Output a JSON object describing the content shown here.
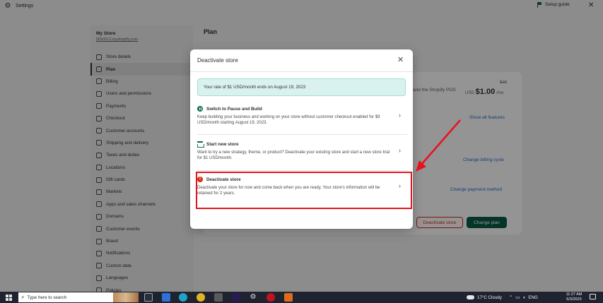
{
  "window": {
    "title": "Settings",
    "setup_guide": "Setup guide",
    "close": "✕"
  },
  "sidebar": {
    "store_name": "My Store",
    "store_url": "5f0c53-2.myshopify.com",
    "items": [
      {
        "label": "Store details",
        "icon": "store-icon"
      },
      {
        "label": "Plan",
        "icon": "plan-icon",
        "active": true
      },
      {
        "label": "Billing",
        "icon": "billing-icon"
      },
      {
        "label": "Users and permissions",
        "icon": "users-icon"
      },
      {
        "label": "Payments",
        "icon": "payments-icon"
      },
      {
        "label": "Checkout",
        "icon": "checkout-icon"
      },
      {
        "label": "Customer accounts",
        "icon": "customer-accounts-icon"
      },
      {
        "label": "Shipping and delivery",
        "icon": "shipping-icon"
      },
      {
        "label": "Taxes and duties",
        "icon": "taxes-icon"
      },
      {
        "label": "Locations",
        "icon": "location-icon"
      },
      {
        "label": "Gift cards",
        "icon": "gift-card-icon"
      },
      {
        "label": "Markets",
        "icon": "markets-icon"
      },
      {
        "label": "Apps and sales channels",
        "icon": "apps-icon"
      },
      {
        "label": "Domains",
        "icon": "domains-icon"
      },
      {
        "label": "Customer events",
        "icon": "customer-events-icon"
      },
      {
        "label": "Brand",
        "icon": "brand-icon"
      },
      {
        "label": "Notifications",
        "icon": "notifications-icon"
      },
      {
        "label": "Custom data",
        "icon": "custom-data-icon"
      },
      {
        "label": "Languages",
        "icon": "languages-icon"
      },
      {
        "label": "Policies",
        "icon": "policies-icon"
      }
    ]
  },
  "main": {
    "page_title": "Plan",
    "pos_text": "and the Shopify POS",
    "price_old": "$29",
    "price_currency": "USD",
    "price_value": "$1.00",
    "price_period": "/mo",
    "show_all_features": "Show all features",
    "change_billing_cycle": "Change billing cycle",
    "change_payment_method": "Change payment method",
    "deactivate_store_button": "Deactivate store",
    "change_plan_button": "Change plan"
  },
  "modal": {
    "title": "Deactivate store",
    "close": "✕",
    "banner": "Your rate of $1 USD/month ends on August 19, 2023",
    "options": [
      {
        "title": "Switch to Pause and Build",
        "description": "Keep building your business and working on your store without customer checkout enabled for $9 USD/month starting August 19, 2023.",
        "icon": "pause-icon"
      },
      {
        "title": "Start new store",
        "description": "Want to try a new strategy, theme, or product? Deactivate your existing store and start a new store trial for $1 USD/month.",
        "icon": "store-icon"
      },
      {
        "title": "Deactivate store",
        "description": "Deactivate your store for now and come back when you are ready. Your store's information will be retained for 2 years.",
        "icon": "warning-icon"
      }
    ],
    "chevron": "›"
  },
  "taskbar": {
    "search_placeholder": "Type here to search",
    "weather": "17°C  Cloudy",
    "language": "ENG",
    "time": "11:27 AM",
    "date": "6/3/2023"
  },
  "colors": {
    "accent": "#0a5c45",
    "danger": "#d72c0d",
    "annotation": "#e8121b",
    "banner_bg": "#d9f2ef"
  }
}
